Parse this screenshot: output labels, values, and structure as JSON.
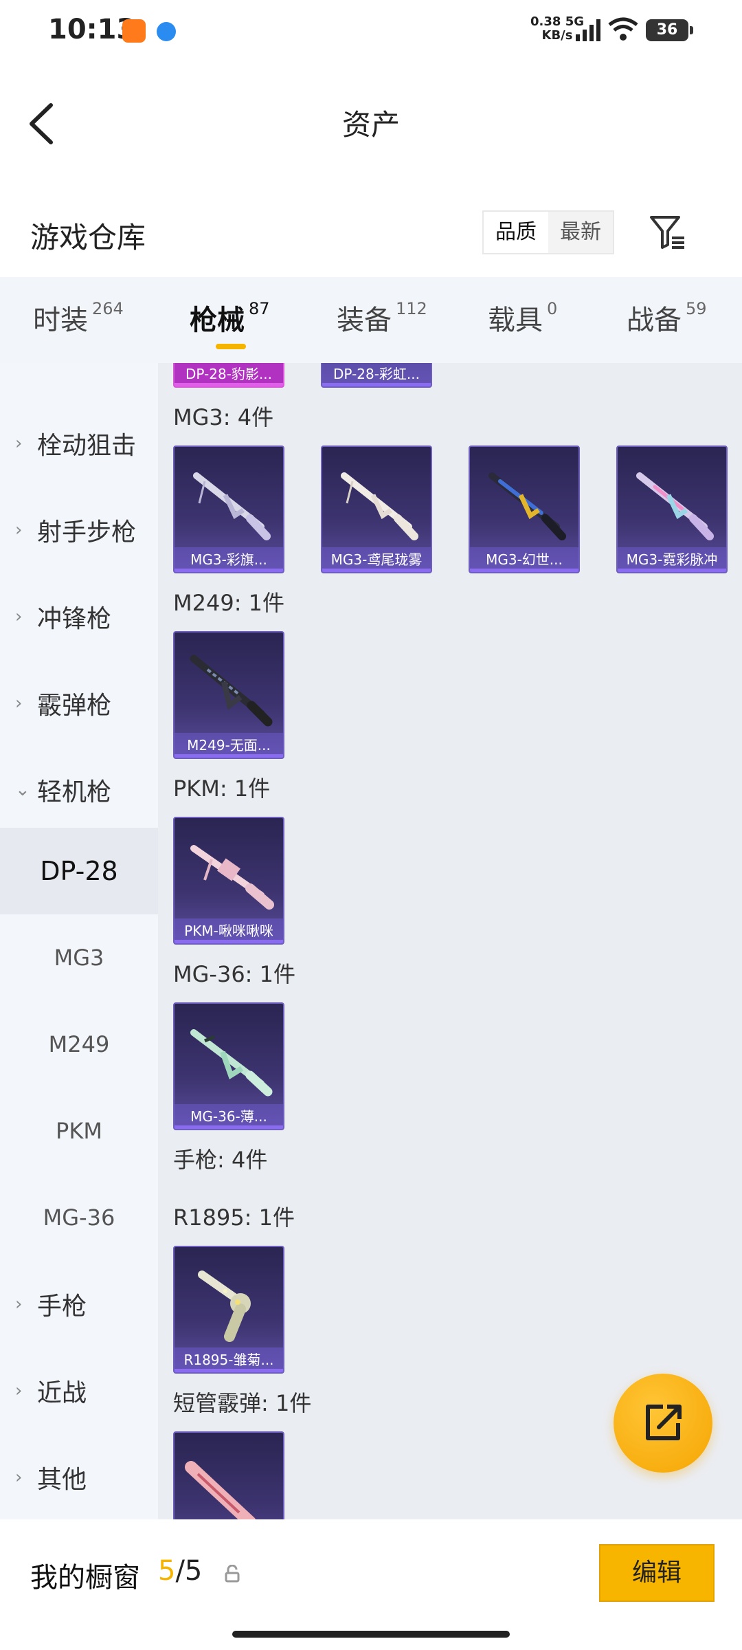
{
  "status_bar": {
    "time": "10:13",
    "net_speed_value": "0.38",
    "net_speed_unit": "KB/s",
    "network": "5G",
    "battery": "36"
  },
  "header": {
    "title": "资产"
  },
  "warehouse": {
    "title": "游戏仓库",
    "sort_options": [
      "品质",
      "最新"
    ],
    "sort_selected": "品质"
  },
  "tabs": [
    {
      "label": "时装",
      "count": "264"
    },
    {
      "label": "枪械",
      "count": "87",
      "active": true
    },
    {
      "label": "装备",
      "count": "112"
    },
    {
      "label": "载具",
      "count": "0"
    },
    {
      "label": "战备",
      "count": "59"
    }
  ],
  "sidebar": {
    "categories": [
      {
        "label": "栓动狙击",
        "chevron": "›"
      },
      {
        "label": "射手步枪",
        "chevron": "›"
      },
      {
        "label": "冲锋枪",
        "chevron": "›"
      },
      {
        "label": "霰弹枪",
        "chevron": "›"
      },
      {
        "label": "轻机枪",
        "chevron": "⌄"
      }
    ],
    "subcategories": [
      {
        "label": "DP-28",
        "selected": true
      },
      {
        "label": "MG3"
      },
      {
        "label": "M249"
      },
      {
        "label": "PKM"
      },
      {
        "label": "MG-36"
      }
    ],
    "categories_after": [
      {
        "label": "手枪",
        "chevron": "›"
      },
      {
        "label": "近战",
        "chevron": "›"
      },
      {
        "label": "其他",
        "chevron": "›"
      }
    ]
  },
  "content": {
    "top_partial_cards": [
      "DP-28-豹影...",
      "DP-28-彩虹..."
    ],
    "groups": [
      {
        "label": "MG3: 4件",
        "items": [
          "MG3-彩旗...",
          "MG3-鸢尾珑雾",
          "MG3-幻世...",
          "MG3-霓彩脉冲"
        ]
      },
      {
        "label": "M249: 1件",
        "items": [
          "M249-无面..."
        ]
      },
      {
        "label": "PKM: 1件",
        "items": [
          "PKM-啾咪啾咪"
        ]
      },
      {
        "label": "MG-36: 1件",
        "items": [
          "MG-36-薄..."
        ]
      },
      {
        "label": "手枪: 4件",
        "items": []
      },
      {
        "label": "R1895: 1件",
        "items": [
          "R1895-雏菊..."
        ]
      },
      {
        "label": "短管霰弹: 1件",
        "items": [
          ""
        ]
      }
    ]
  },
  "bottom_bar": {
    "showcase_label": "我的橱窗",
    "showcase_used": "5",
    "showcase_total": "/5",
    "edit_label": "编辑"
  },
  "icons": {
    "back": "back-arrow-icon",
    "filter": "filter-icon",
    "fab": "share-icon",
    "lock": "lock-icon"
  },
  "colors": {
    "accent": "#f5b400",
    "card_purple": "#3d3470",
    "card_pink": "#c13ec9"
  }
}
